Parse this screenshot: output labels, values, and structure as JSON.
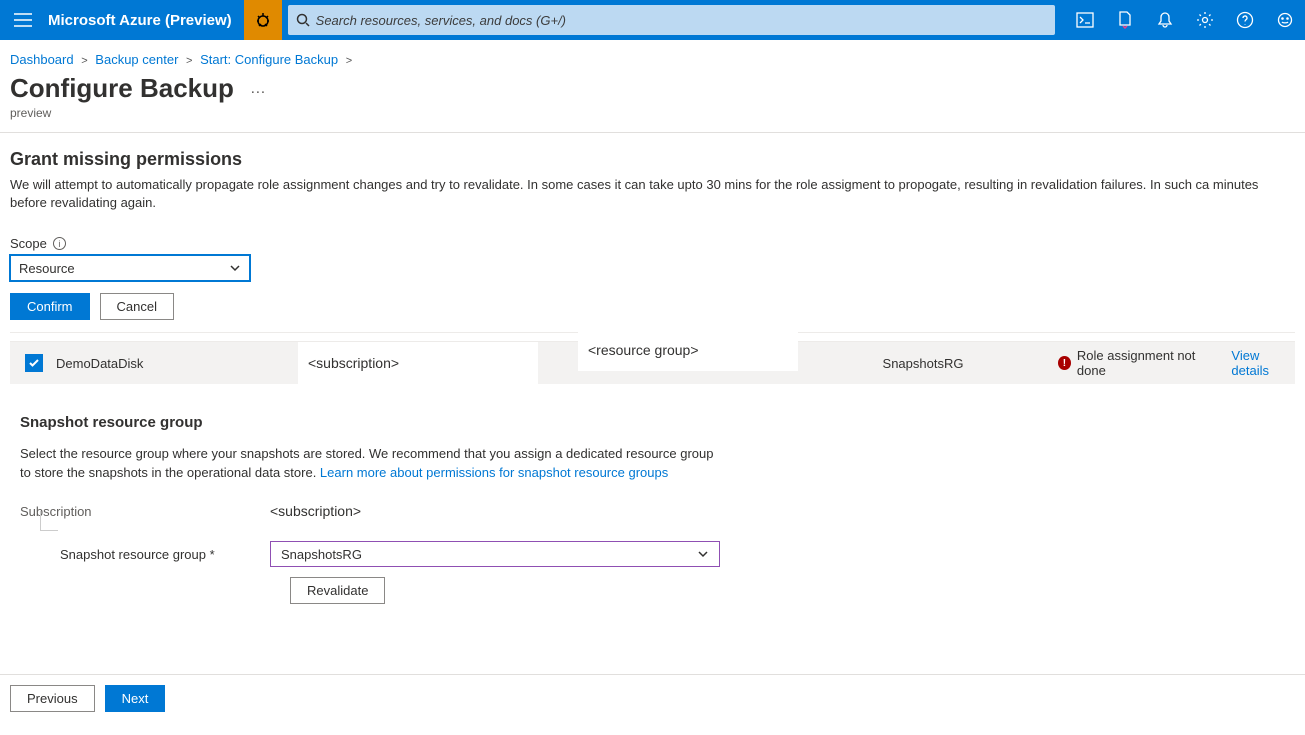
{
  "header": {
    "brand": "Microsoft Azure (Preview)",
    "search_placeholder": "Search resources, services, and docs (G+/)"
  },
  "breadcrumb": {
    "items": [
      "Dashboard",
      "Backup center",
      "Start: Configure Backup"
    ]
  },
  "page": {
    "title": "Configure Backup",
    "subtitle": "preview"
  },
  "grant": {
    "title": "Grant missing permissions",
    "desc": "We will attempt to automatically propagate role assignment changes and try to revalidate. In some cases it can take upto 30 mins for the role assigment to propogate, resulting in revalidation failures. In such ca minutes before revalidating again.",
    "scope_label": "Scope",
    "scope_value": "Resource",
    "confirm": "Confirm",
    "cancel": "Cancel"
  },
  "table": {
    "row": {
      "name": "DemoDataDisk",
      "subscription": "<subscription>",
      "resource_group": "<resource group>",
      "snapshot_rg": "SnapshotsRG",
      "status": "Role assignment not done",
      "view_details": "View details"
    }
  },
  "snapshot": {
    "title": "Snapshot resource group",
    "desc_pre": "Select the resource group where your snapshots are stored. We recommend that you assign a dedicated resource group to store the snapshots in the operational data store. ",
    "learn_link": "Learn more about permissions for snapshot resource groups",
    "subscription_label": "Subscription",
    "subscription_value": "<subscription>",
    "rg_label": "Snapshot resource group *",
    "rg_value": "SnapshotsRG",
    "revalidate": "Revalidate"
  },
  "footer": {
    "previous": "Previous",
    "next": "Next"
  }
}
